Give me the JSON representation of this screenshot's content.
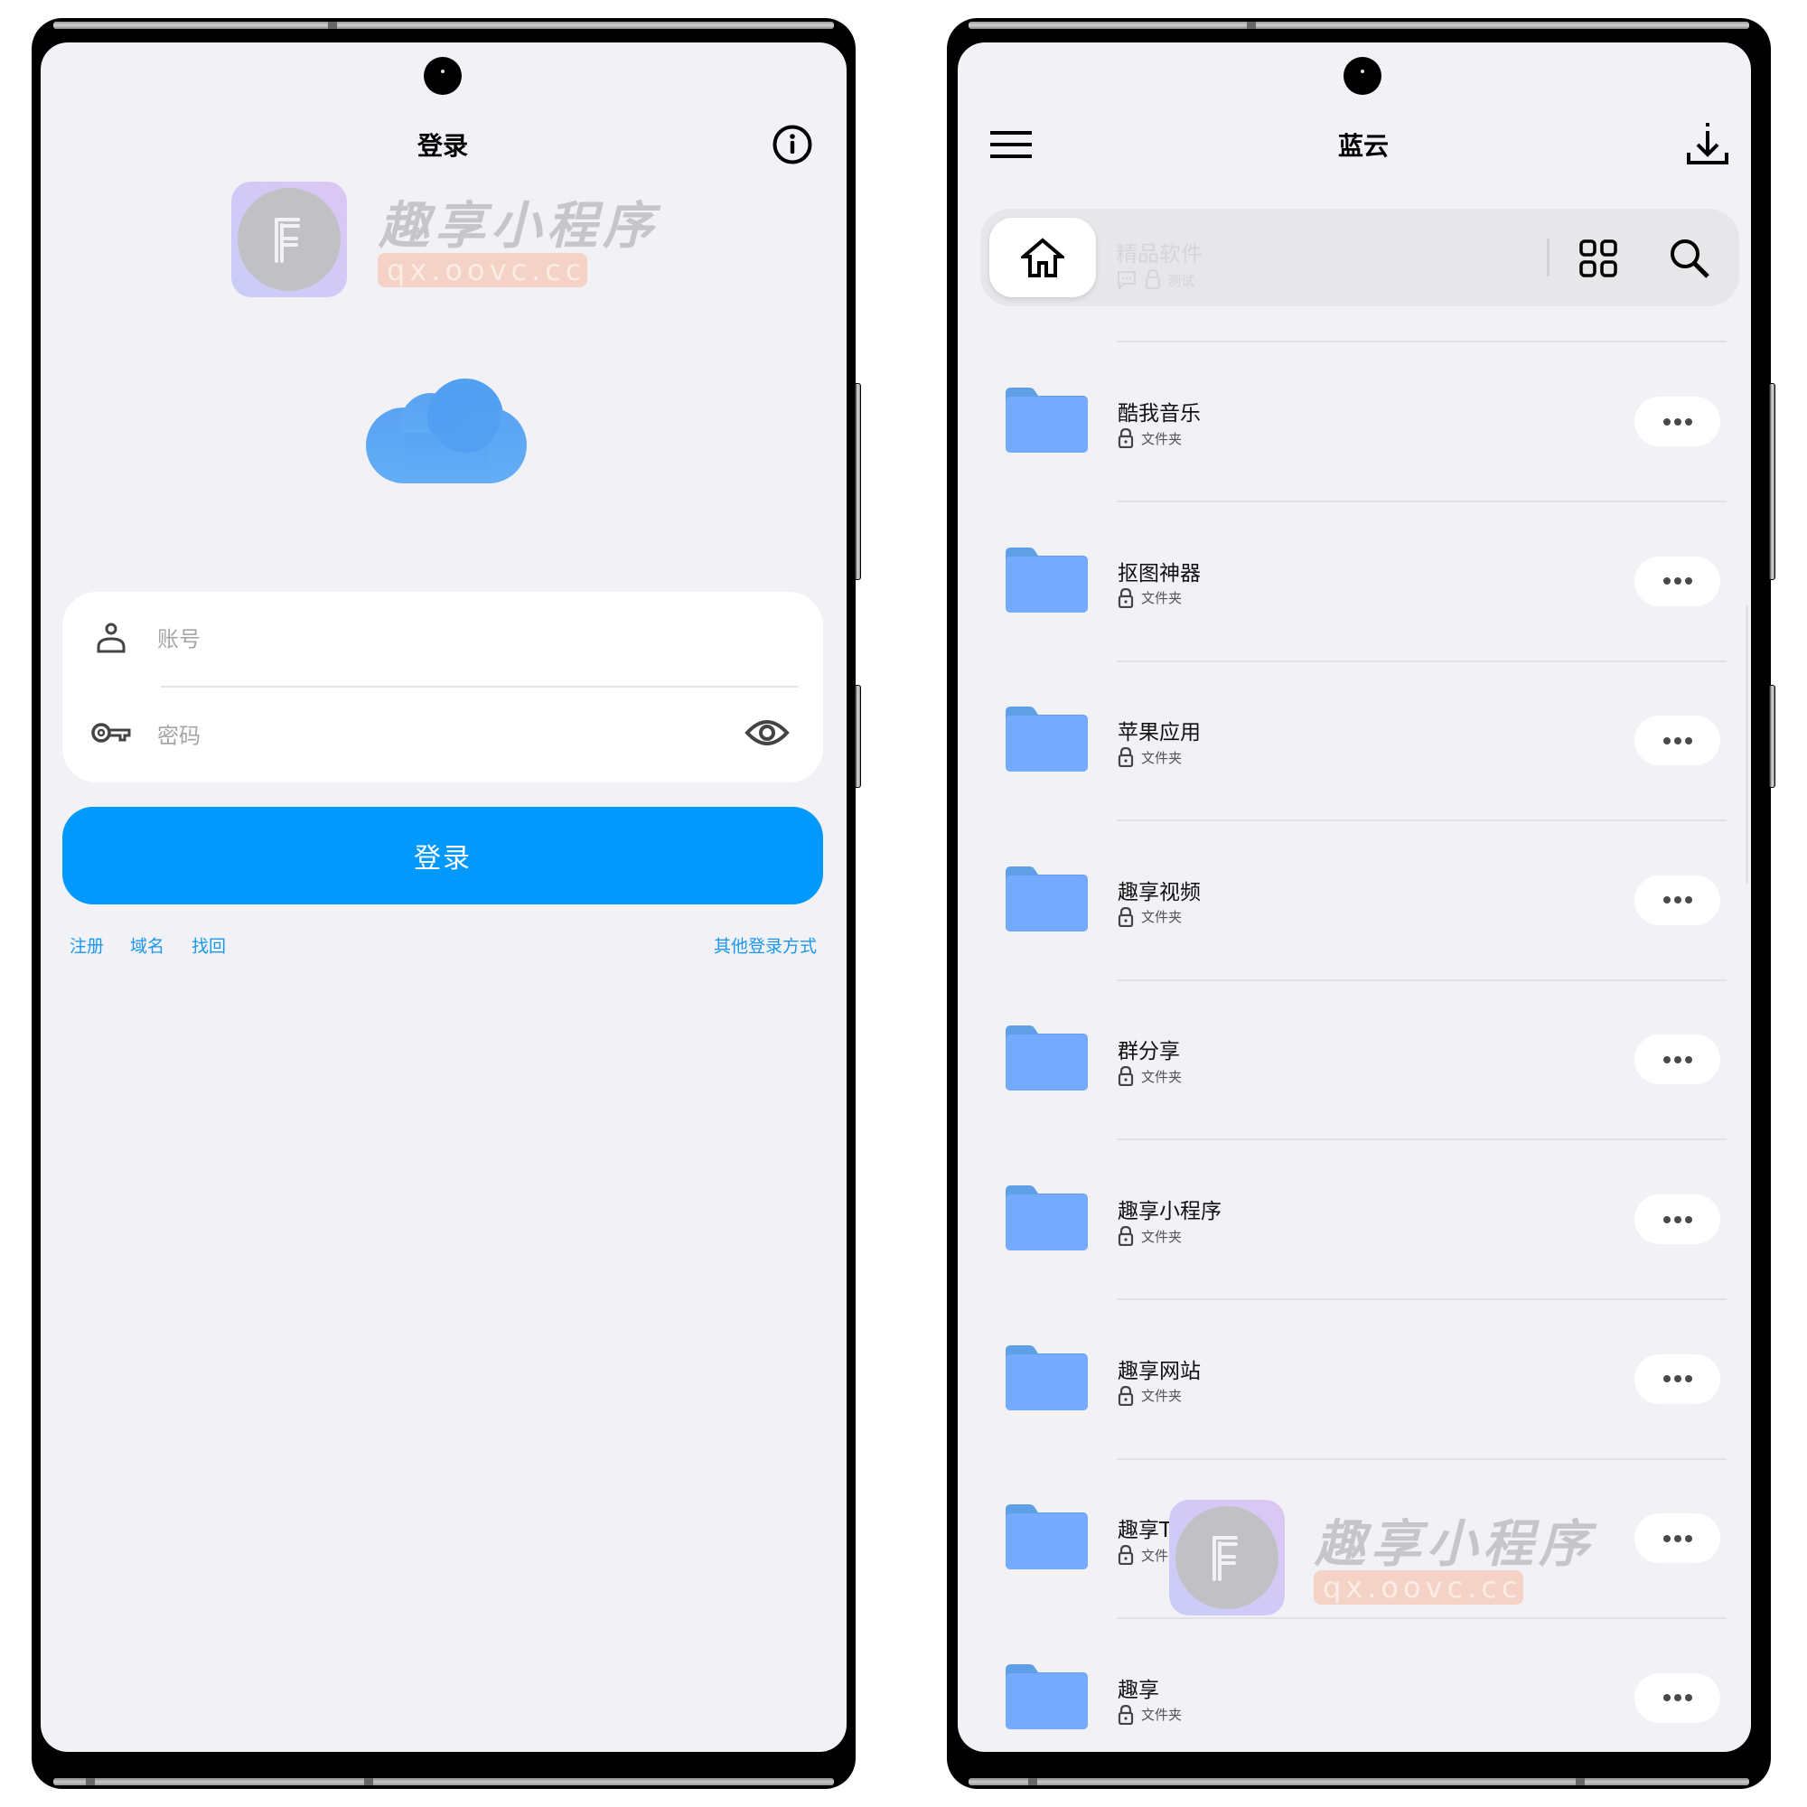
{
  "login_screen": {
    "title": "登录",
    "info_icon": "info-circle-icon",
    "watermark": {
      "brand": "趣享小程序",
      "url": "qx.oovc.cc",
      "logo_letter": "F"
    },
    "logo_icon": "cloud-icon",
    "form": {
      "account": {
        "icon": "user-icon",
        "placeholder": "账号",
        "value": ""
      },
      "password": {
        "icon": "key-icon",
        "placeholder": "密码",
        "value": "",
        "toggle_icon": "eye-icon"
      }
    },
    "login_button": "登录",
    "links": {
      "register": "注册",
      "domain": "域名",
      "recover": "找回",
      "other_login": "其他登录方式"
    },
    "colors": {
      "accent": "#0299fd",
      "link": "#1b98ee",
      "background": "#f1f1f6"
    }
  },
  "files_screen": {
    "title": "蓝云",
    "menu_icon": "hamburger-menu-icon",
    "download_icon": "download-icon",
    "breadcrumb": {
      "home_icon": "home-icon",
      "folder_name": "精品软件",
      "meta_icons": [
        "comment-icon",
        "lock-icon"
      ],
      "meta_text": "测试",
      "grid_icon": "grid-view-icon",
      "search_icon": "search-icon"
    },
    "items": [
      {
        "name": "酷我音乐",
        "type": "文件夹"
      },
      {
        "name": "抠图神器",
        "type": "文件夹"
      },
      {
        "name": "苹果应用",
        "type": "文件夹"
      },
      {
        "name": "趣享视频",
        "type": "文件夹"
      },
      {
        "name": "群分享",
        "type": "文件夹"
      },
      {
        "name": "趣享小程序",
        "type": "文件夹"
      },
      {
        "name": "趣享网站",
        "type": "文件夹"
      },
      {
        "name": "趣享TV",
        "type": "文件夹"
      },
      {
        "name": "趣享",
        "type": "文件夹"
      }
    ],
    "watermark": {
      "brand": "趣享小程序",
      "url": "qx.oovc.cc",
      "logo_letter": "F"
    },
    "colors": {
      "folder_body": "#74aaff",
      "folder_tab": "#5f9fe6"
    }
  }
}
